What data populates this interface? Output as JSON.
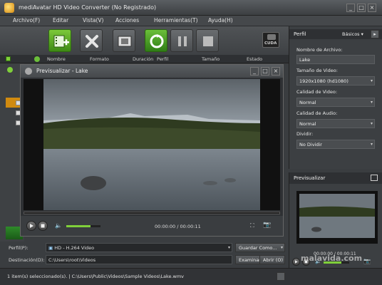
{
  "window": {
    "title": "mediAvatar HD Video Converter (No Registrado)",
    "buttons": {
      "minimize": "_",
      "maximize": "□",
      "close": "×"
    }
  },
  "menu": [
    "Archivo(F)",
    "Editar",
    "Vista(V)",
    "Acciones",
    "Herramientas(T)",
    "Ayuda(H)"
  ],
  "columns": [
    "Nombre",
    "Formato",
    "Duración",
    "Perfil",
    "Tamaño",
    "Estado"
  ],
  "cuda_label": "CUDA",
  "preview_window": {
    "title": "Previsualizar - Lake",
    "time": "00:00:00 / 00:00:11",
    "volume_fraction": 0.7
  },
  "right_panel": {
    "header": "Perfil",
    "mode": "Básicos",
    "fields": [
      {
        "label": "Nombre de Archivo:",
        "value": "Lake"
      },
      {
        "label": "Tamaño de Video:",
        "value": "1920x1080 (hd1080)",
        "dropdown": true
      },
      {
        "label": "Calidad de Video:",
        "value": "Normal",
        "dropdown": true
      },
      {
        "label": "Calidad de Audio:",
        "value": "Normal",
        "dropdown": true
      },
      {
        "label": "Dividir:",
        "value": "No Dividir",
        "dropdown": true
      }
    ]
  },
  "preview_panel": {
    "header": "Previsualizar",
    "time": "00:00:00 / 00:00:11",
    "watermark": "malavida.com"
  },
  "bottom": {
    "profile_label": "Perfil(P):",
    "profile_value": "HD - H.264 Video",
    "save_as": "Guardar Como...",
    "dest_label": "Destinación(D):",
    "dest_value": "C:\\Users\\root\\Videos",
    "browse": "Examinar(B)...",
    "open": "Abrir (O)"
  },
  "status": "1 item(s) seleccionado(s). | C:\\Users\\Public\\Videos\\Sample Videos\\Lake.wmv",
  "colors": {
    "accent_green": "#5bb52a",
    "orange": "#d08a10"
  }
}
